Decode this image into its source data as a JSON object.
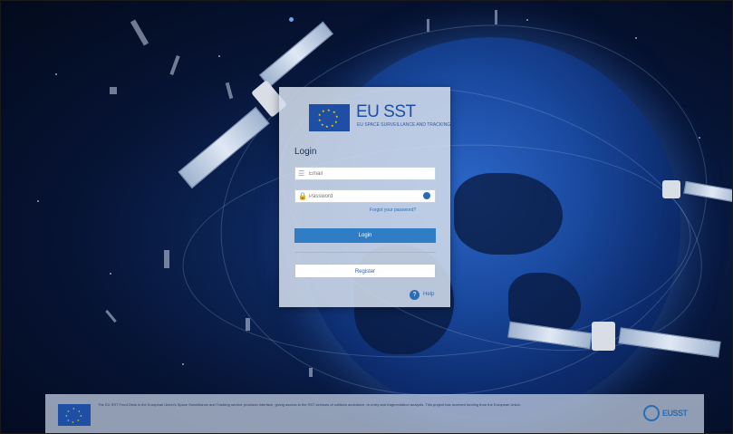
{
  "brand": {
    "title": "EU SST",
    "subtitle": "EU SPACE SURVEILLANCE AND TRACKING"
  },
  "login_form": {
    "heading": "Login",
    "email_placeholder": "Email",
    "password_placeholder": "Password",
    "forgot_label": "Forgot your password?",
    "login_button": "Login",
    "register_button": "Register",
    "help_label": "Help"
  },
  "footer": {
    "text": "The EU SST Front Desk is the European Union's Space Surveillance and Tracking service provision interface, giving access to the SST services of collision avoidance, re-entry and fragmentation analysis. This project has received funding from the European Union.",
    "partner_logo_text": "EUSST"
  },
  "colors": {
    "accent": "#2f7ec5",
    "eu_blue": "#1f4fa5",
    "eu_gold": "#ffd400"
  },
  "icons": [
    "user-icon",
    "lock-icon",
    "eye-icon",
    "help-icon"
  ]
}
